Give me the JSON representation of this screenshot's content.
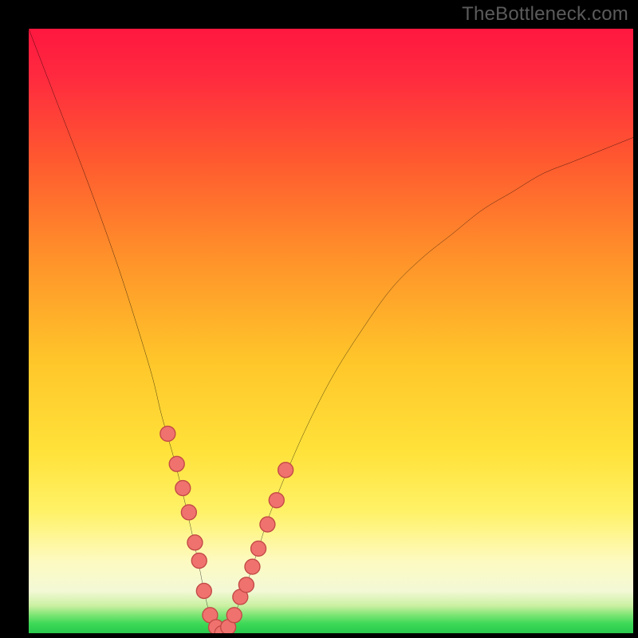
{
  "watermark": "TheBottleneck.com",
  "colors": {
    "bg": "#000000",
    "top": "#ff173f",
    "mid_upper": "#ff8a2a",
    "mid": "#ffd22a",
    "mid_lower": "#ffee72",
    "pale": "#fbf9cf",
    "green": "#3bd856",
    "curve": "#000000",
    "marker_fill": "#f0726e",
    "marker_stroke": "#c24946"
  },
  "chart_data": {
    "type": "line",
    "title": "",
    "xlabel": "",
    "ylabel": "",
    "xlim": [
      0,
      100
    ],
    "ylim": [
      0,
      100
    ],
    "x": [
      0,
      5,
      10,
      15,
      20,
      22,
      24,
      26,
      28,
      29,
      30,
      31,
      32,
      33,
      34,
      36,
      38,
      40,
      45,
      50,
      55,
      60,
      65,
      70,
      75,
      80,
      85,
      90,
      95,
      100
    ],
    "y": [
      100,
      87,
      74,
      60,
      44,
      36,
      29,
      21,
      12,
      7,
      3,
      1,
      0,
      1,
      3,
      8,
      14,
      20,
      32,
      42,
      50,
      57,
      62,
      66,
      70,
      73,
      76,
      78,
      80,
      82
    ],
    "markers_x": [
      23,
      24.5,
      25.5,
      26.5,
      27.5,
      28.2,
      29,
      30,
      31,
      32,
      33,
      34,
      35,
      36,
      37,
      38,
      39.5,
      41,
      42.5
    ],
    "markers_y": [
      33,
      28,
      24,
      20,
      15,
      12,
      7,
      3,
      1,
      0,
      1,
      3,
      6,
      8,
      11,
      14,
      18,
      22,
      27
    ]
  }
}
